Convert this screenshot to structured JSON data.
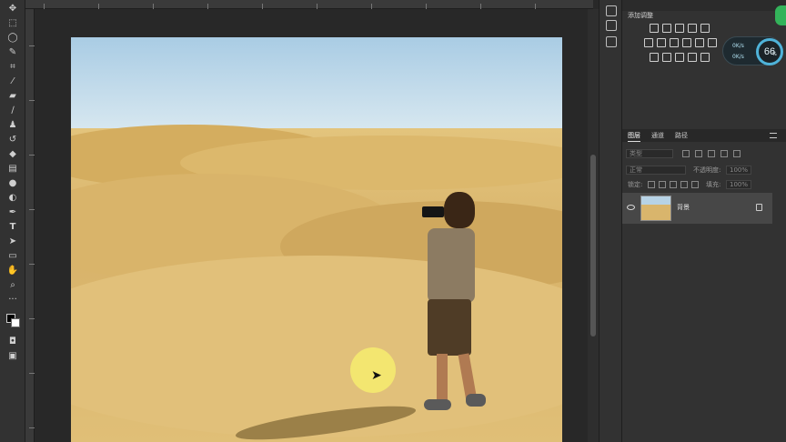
{
  "toolbar": {
    "tools": [
      "move-icon",
      "marquee-icon",
      "lasso-icon",
      "quick-select-icon",
      "crop-icon",
      "eyedropper-icon",
      "healing-brush-icon",
      "brush-icon",
      "stamp-icon",
      "history-brush-icon",
      "eraser-icon",
      "gradient-icon",
      "blur-icon",
      "dodge-icon",
      "pen-icon",
      "type-icon",
      "path-select-icon",
      "shape-icon",
      "hand-icon",
      "zoom-icon",
      "more-icon",
      "color-swap-icon",
      "quick-mask-icon",
      "screen-mode-icon"
    ]
  },
  "colors": {
    "foreground": "#000000",
    "background": "#ffffff",
    "cursor_highlight": "#f6ec6e",
    "perf_ring": "#4fb3d9",
    "badge": "#33b35a"
  },
  "adjustments": {
    "title": "添加调整"
  },
  "layers": {
    "tabs": [
      "图层",
      "通道",
      "路径"
    ],
    "filter_label": "类型",
    "blend_mode": "正常",
    "opacity_label": "不透明度:",
    "opacity_value": "100%",
    "lock_label": "锁定:",
    "fill_label": "填充:",
    "fill_value": "100%",
    "items": [
      {
        "name": "背景",
        "locked": true,
        "visible": true
      }
    ]
  },
  "perf": {
    "up": "0K/s",
    "down": "0K/s",
    "value": "66",
    "unit": "%"
  }
}
